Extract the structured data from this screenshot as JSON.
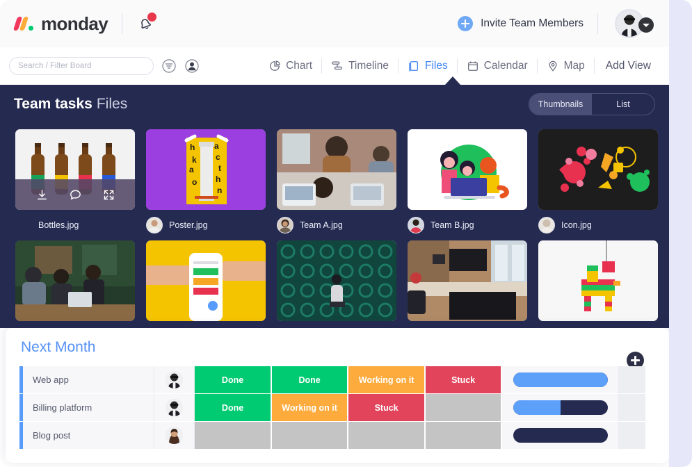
{
  "topbar": {
    "brand": "monday",
    "notification_icon": "bell-icon",
    "notification_badge": "",
    "invite_label": "Invite Team Members",
    "invite_icon": "plus-circle-icon",
    "avatar_icon": "user-avatar",
    "caret_icon": "chevron-down-icon"
  },
  "viewbar": {
    "search": {
      "placeholder": "Search / Filter Board",
      "value": ""
    },
    "filter_icon": "filter-icon",
    "person_icon": "person-circle-icon",
    "views": [
      {
        "label": "Chart",
        "icon": "pie-chart-icon",
        "active": false
      },
      {
        "label": "Timeline",
        "icon": "timeline-icon",
        "active": false
      },
      {
        "label": "Files",
        "icon": "files-icon",
        "active": true
      },
      {
        "label": "Calendar",
        "icon": "calendar-icon",
        "active": false
      },
      {
        "label": "Map",
        "icon": "map-pin-icon",
        "active": false
      }
    ],
    "add_view_label": "Add View"
  },
  "files_panel": {
    "board_name": "Team tasks",
    "section_name": "Files",
    "toggle": {
      "options": [
        "Thumbnails",
        "List"
      ],
      "selected": "Thumbnails"
    },
    "hover_actions": [
      {
        "name": "download-icon"
      },
      {
        "name": "comment-icon"
      },
      {
        "name": "expand-icon"
      }
    ],
    "files": [
      {
        "name": "Bottles.jpg",
        "thumb": "beer-bottles",
        "avatar": null,
        "hovered": true
      },
      {
        "name": "Poster.jpg",
        "thumb": "hackathon-poster",
        "avatar": "avatar-1",
        "hovered": false
      },
      {
        "name": "Team A.jpg",
        "thumb": "team-photo-a",
        "avatar": "avatar-2",
        "hovered": false
      },
      {
        "name": "Team B.jpg",
        "thumb": "team-illustration",
        "avatar": "avatar-3",
        "hovered": false
      },
      {
        "name": "Icon.jpg",
        "thumb": "icon-collage",
        "avatar": "avatar-4",
        "hovered": false
      }
    ],
    "files_row2": [
      {
        "thumb": "cafe-meeting"
      },
      {
        "thumb": "phone-hands-yellow"
      },
      {
        "thumb": "green-pipes"
      },
      {
        "thumb": "office-desks"
      },
      {
        "thumb": "pinata"
      }
    ]
  },
  "board": {
    "group_title": "Next Month",
    "add_button_icon": "plus-circle-icon",
    "colors": {
      "done": "#00ca72",
      "working": "#fdab3d",
      "stuck": "#e2445c",
      "empty": "#c4c4c4",
      "progress_fill": "#5da0fa",
      "progress_track": "#252a51",
      "group": "#579bfc"
    },
    "rows": [
      {
        "name": "Web app",
        "avatar": "avatar-m1",
        "statuses": [
          {
            "label": "Done",
            "color": "#00ca72"
          },
          {
            "label": "Done",
            "color": "#00ca72"
          },
          {
            "label": "Working on it",
            "color": "#fdab3d"
          },
          {
            "label": "Stuck",
            "color": "#e2445c"
          }
        ],
        "progress": 100
      },
      {
        "name": "Billing platform",
        "avatar": "avatar-m2",
        "statuses": [
          {
            "label": "Done",
            "color": "#00ca72"
          },
          {
            "label": "Working on it",
            "color": "#fdab3d"
          },
          {
            "label": "Stuck",
            "color": "#e2445c"
          },
          {
            "label": "",
            "color": "#c4c4c4"
          }
        ],
        "progress": 50
      },
      {
        "name": "Blog post",
        "avatar": "avatar-f1",
        "statuses": [
          {
            "label": "",
            "color": "#c4c4c4"
          },
          {
            "label": "",
            "color": "#c4c4c4"
          },
          {
            "label": "",
            "color": "#c4c4c4"
          },
          {
            "label": "",
            "color": "#c4c4c4"
          }
        ],
        "progress": 0
      }
    ]
  }
}
